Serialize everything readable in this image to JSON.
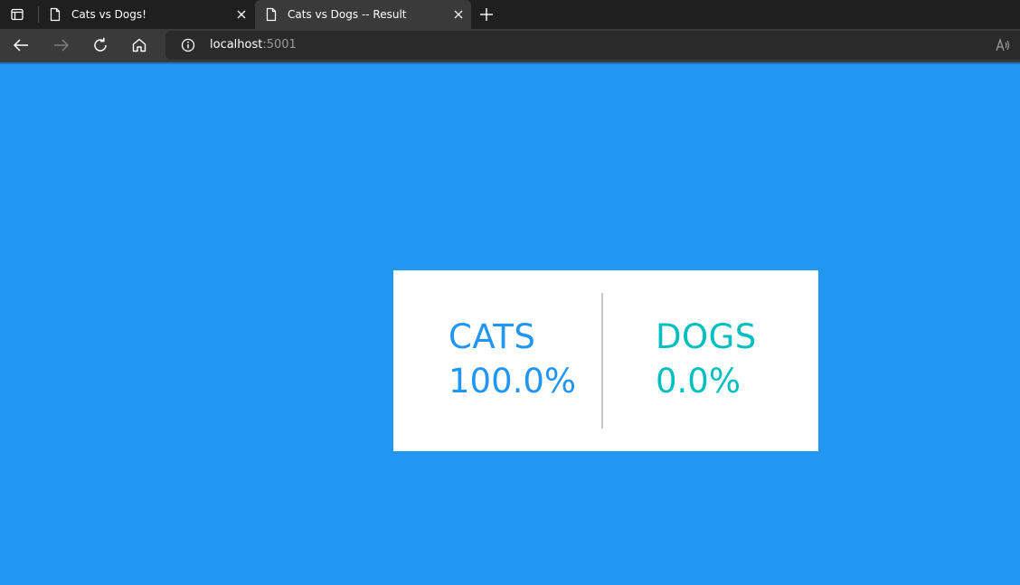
{
  "browser": {
    "tabs": [
      {
        "title": "Cats vs Dogs!",
        "active": false
      },
      {
        "title": "Cats vs Dogs -- Result",
        "active": true
      }
    ],
    "address": {
      "host": "localhost",
      "port": ":5001"
    }
  },
  "result": {
    "option_a": {
      "label": "CATS",
      "percent": "100.0%",
      "color": "#2196f3"
    },
    "option_b": {
      "label": "DOGS",
      "percent": "0.0%",
      "color": "#00bfbf"
    }
  },
  "colors": {
    "page_background": "#2196f3",
    "card_background": "#ffffff"
  }
}
